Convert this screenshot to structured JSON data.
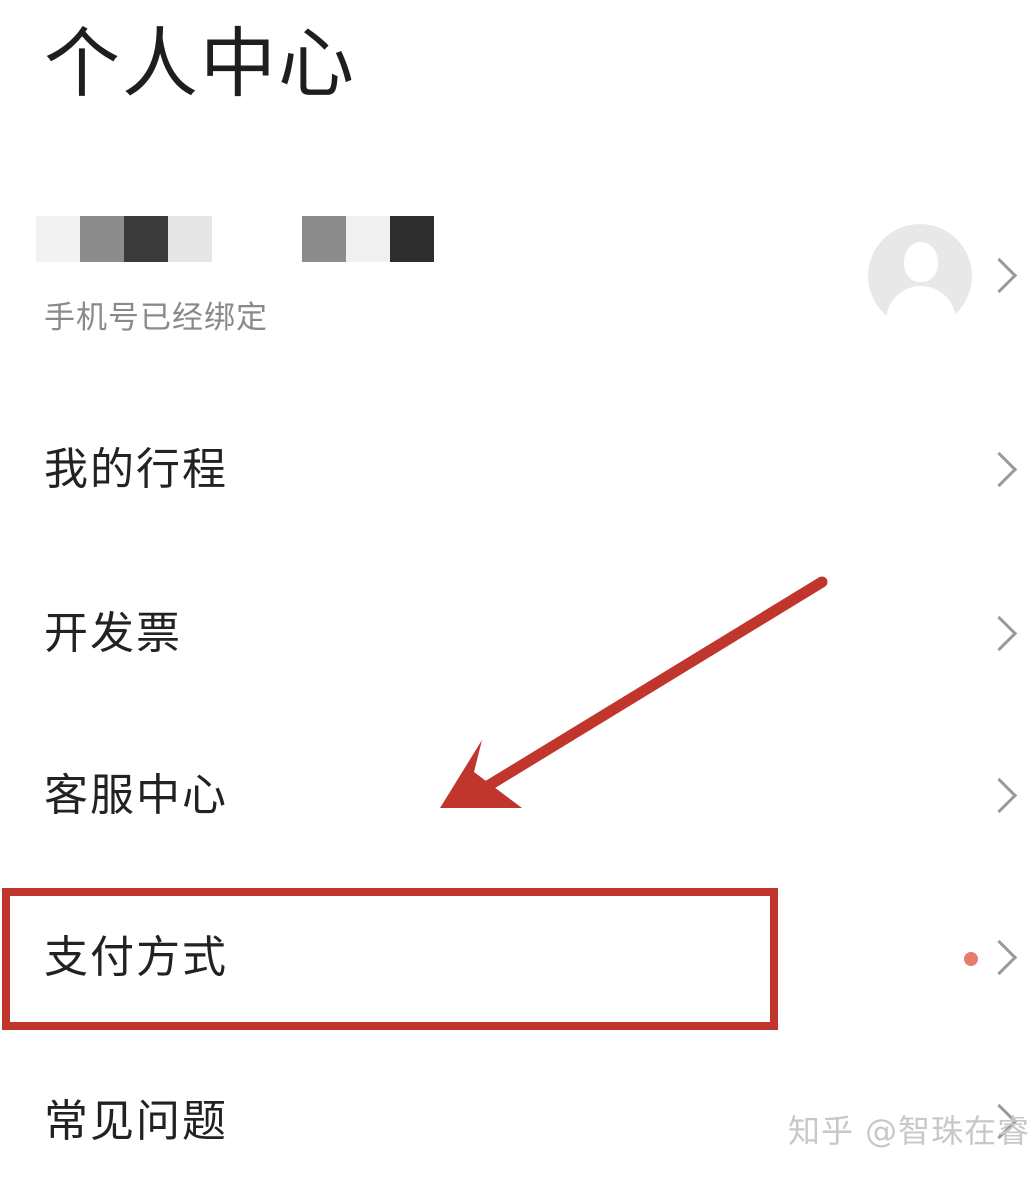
{
  "header": {
    "title": "个人中心"
  },
  "profile": {
    "phone_status": "手机号已经绑定",
    "avatar_icon": "default-user-avatar-icon",
    "mask_colors": [
      "#f2f2f2",
      "#8c8c8c",
      "#3a3a3a",
      "#e6e6e6",
      "#8c8c8c",
      "#f0f0f0",
      "#2e2e2e"
    ]
  },
  "menu": {
    "items": [
      {
        "label": "我的行程",
        "has_dot": false
      },
      {
        "label": "开发票",
        "has_dot": false
      },
      {
        "label": "客服中心",
        "has_dot": false
      },
      {
        "label": "支付方式",
        "has_dot": true
      },
      {
        "label": "常见问题",
        "has_dot": false
      }
    ]
  },
  "annotation": {
    "highlight_color": "#c0362c",
    "arrow_color": "#c0362c"
  },
  "watermark": {
    "text": "知乎 @智珠在睿"
  },
  "colors": {
    "background": "#ffffff",
    "text_primary": "#222222",
    "text_secondary": "#8a8a8a",
    "chevron": "#9a9a9a",
    "notice_dot": "#e87a6e"
  }
}
